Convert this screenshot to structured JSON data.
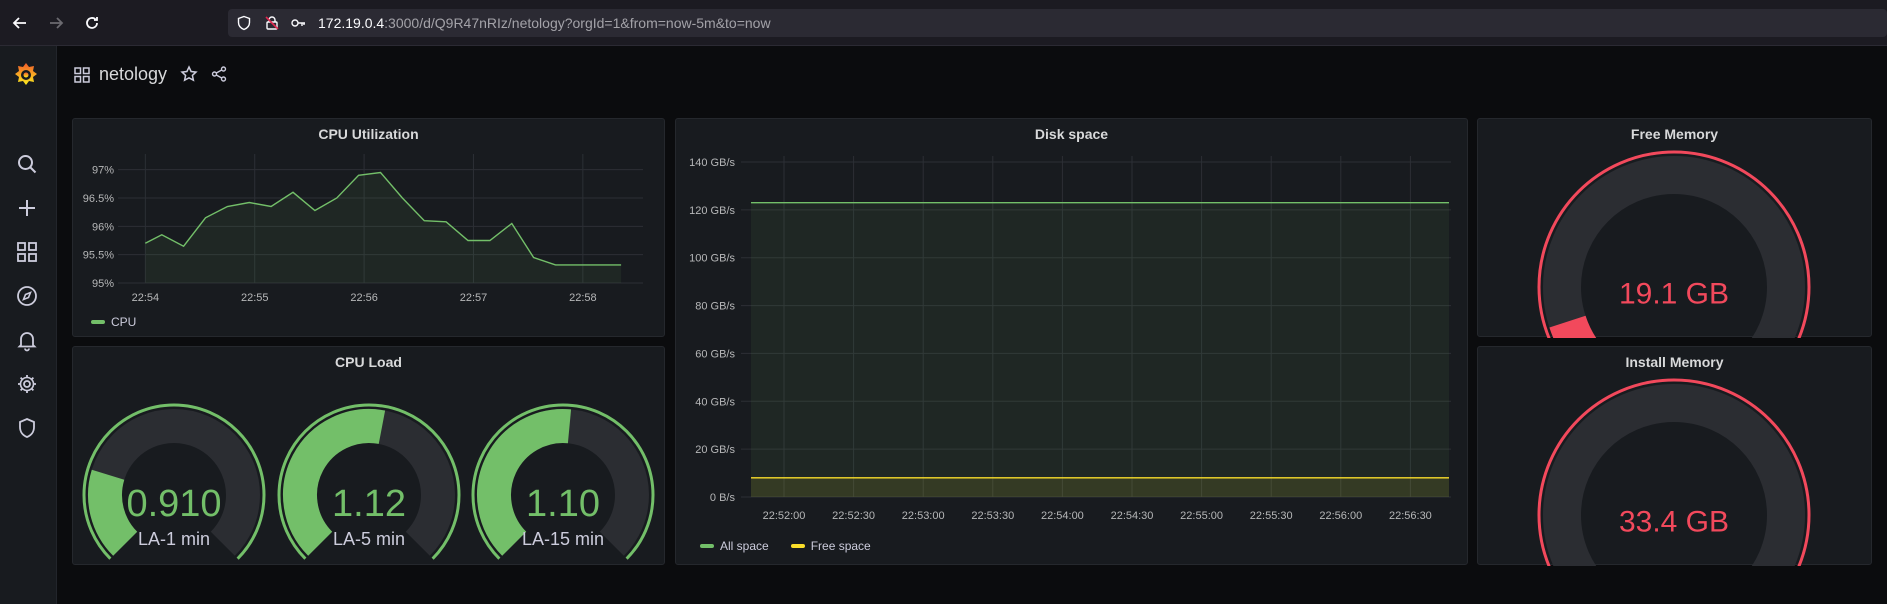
{
  "browser": {
    "url_host": "172.19.0.4",
    "url_rest": ":3000/d/Q9R47nRIz/netology?orgId=1&from=now-5m&to=now"
  },
  "sidemenu": {
    "items": [
      "grafana-logo",
      "search-icon",
      "plus-icon",
      "dashboards-icon",
      "explore-icon",
      "alerting-icon",
      "settings-icon",
      "shield-icon"
    ]
  },
  "dashboard": {
    "title": "netology"
  },
  "colors": {
    "green": "#73bf69",
    "yellow": "#fade2a",
    "red": "#f2495c",
    "track": "#2b2d32"
  },
  "panels": {
    "cpu_util": {
      "title": "CPU Utilization",
      "legend": "CPU"
    },
    "disk": {
      "title": "Disk space",
      "legend_all": "All space",
      "legend_free": "Free space"
    },
    "free_mem": {
      "title": "Free Memory",
      "value": "19.1 GB",
      "fraction": 0.1
    },
    "cpu_load": {
      "title": "CPU Load",
      "gauges": [
        {
          "value": "0.910",
          "label": "LA-1 min",
          "fraction": 0.23
        },
        {
          "value": "1.12",
          "label": "LA-5 min",
          "fraction": 0.54
        },
        {
          "value": "1.10",
          "label": "LA-15 min",
          "fraction": 0.52
        }
      ]
    },
    "install_mem": {
      "title": "Install Memory",
      "value": "33.4 GB",
      "fraction": 0.0
    }
  },
  "chart_data": [
    {
      "type": "line",
      "panel": "CPU Utilization",
      "y_ticks": [
        "97%",
        "96.5%",
        "96%",
        "95.5%",
        "95%"
      ],
      "ylim": [
        95,
        97.1
      ],
      "x_ticks": [
        "22:54",
        "22:55",
        "22:56",
        "22:57",
        "22:58"
      ],
      "series": [
        {
          "name": "CPU",
          "x": [
            0,
            0.15,
            0.35,
            0.55,
            0.75,
            0.95,
            1.15,
            1.35,
            1.55,
            1.75,
            1.95,
            2.15,
            2.35,
            2.55,
            2.75,
            2.95,
            3.15,
            3.35,
            3.55,
            3.75,
            3.95,
            4.15,
            4.35
          ],
          "values": [
            95.7,
            95.85,
            95.65,
            96.15,
            96.35,
            96.42,
            96.35,
            96.6,
            96.28,
            96.5,
            96.9,
            96.95,
            96.5,
            96.1,
            96.08,
            95.75,
            95.75,
            96.05,
            95.45,
            95.32,
            95.32,
            95.32,
            95.32
          ]
        }
      ],
      "xlim": [
        -0.25,
        4.55
      ]
    },
    {
      "type": "area",
      "panel": "Disk space",
      "y_ticks": [
        "140 GB/s",
        "120 GB/s",
        "100 GB/s",
        "80 GB/s",
        "60 GB/s",
        "40 GB/s",
        "20 GB/s",
        "0 B/s"
      ],
      "ylim": [
        0,
        140
      ],
      "x_ticks": [
        "22:52:00",
        "22:52:30",
        "22:53:00",
        "22:53:30",
        "22:54:00",
        "22:54:30",
        "22:55:00",
        "22:55:30",
        "22:56:00",
        "22:56:30"
      ],
      "series": [
        {
          "name": "All space",
          "values": [
            123,
            123
          ]
        },
        {
          "name": "Free space",
          "values": [
            8,
            8
          ]
        }
      ]
    }
  ]
}
